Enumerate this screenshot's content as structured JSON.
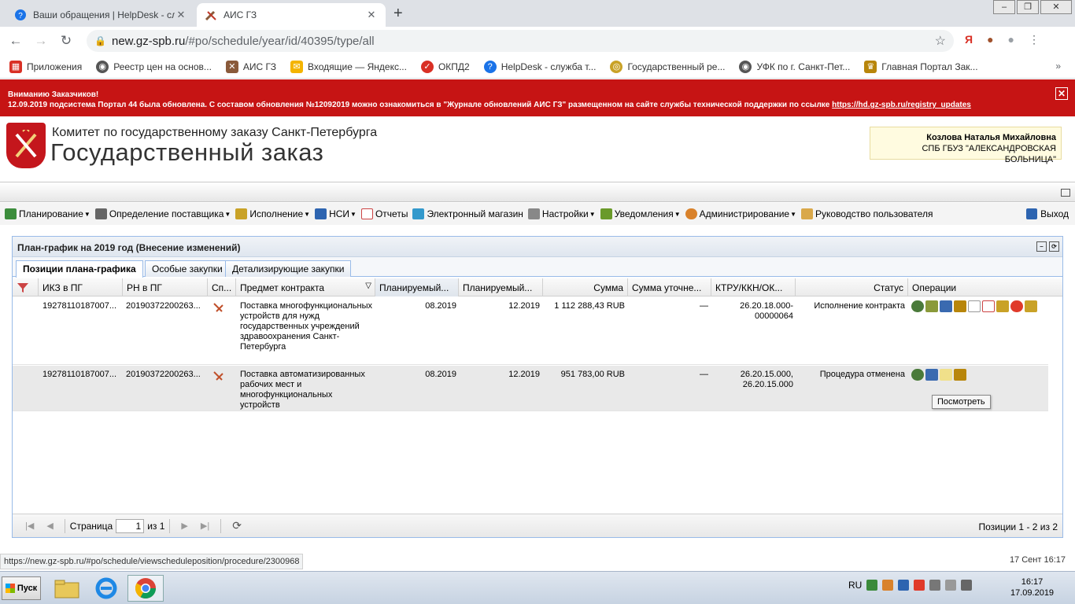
{
  "browser": {
    "tabs": [
      {
        "label": "Ваши обращения | HelpDesk - служ"
      },
      {
        "label": "АИС ГЗ"
      }
    ],
    "url_host": "new.gz-spb.ru",
    "url_path": "/#po/schedule/year/id/40395/type/all",
    "yandex": "Я",
    "bookmarks": [
      {
        "label": "Приложения",
        "color": "#d93025"
      },
      {
        "label": "Реестр цен на основ...",
        "color": "#555555"
      },
      {
        "label": "АИС ГЗ",
        "color": "#8a5a3a"
      },
      {
        "label": "Входящие — Яндекс...",
        "color": "#f4b400"
      },
      {
        "label": "ОКПД2",
        "color": "#d93025"
      },
      {
        "label": "HelpDesk - служба т...",
        "color": "#1a73e8"
      },
      {
        "label": "Государственный ре...",
        "color": "#c9a227"
      },
      {
        "label": "УФК по г. Санкт-Пет...",
        "color": "#555555"
      },
      {
        "label": "Главная Портал Зак...",
        "color": "#b8860b"
      }
    ],
    "bookmarks_more": "»"
  },
  "alert": {
    "line1": "Вниманию Заказчиков!",
    "line2": "12.09.2019 подсистема Портал 44 была обновлена. С составом обновления №12092019 можно ознакомиться в \"Журнале обновлений АИС ГЗ\" размещенном на сайте службы технической поддержки по ссылке",
    "link": "https://hd.gz-spb.ru/registry_updates"
  },
  "header": {
    "org_line1": "Комитет по государственному заказу Санкт-Петербурга",
    "org_line2": "Государственный заказ",
    "user_name": "Козлова Наталья Михайловна",
    "user_org": "СПБ ГБУЗ \"АЛЕКСАНДРОВСКАЯ БОЛЬНИЦА\""
  },
  "menu": {
    "items": [
      {
        "label": "Планирование",
        "dropdown": true,
        "color": "#3c8d3c"
      },
      {
        "label": "Определение поставщика",
        "dropdown": true,
        "color": "#666666"
      },
      {
        "label": "Исполнение",
        "dropdown": true,
        "color": "#c9a227"
      },
      {
        "label": "НСИ",
        "dropdown": true,
        "color": "#2d64b0"
      },
      {
        "label": "Отчеты",
        "dropdown": false,
        "color": "#cc4444"
      },
      {
        "label": "Электронный магазин",
        "dropdown": false,
        "color": "#3399cc"
      },
      {
        "label": "Настройки",
        "dropdown": true,
        "color": "#888888"
      },
      {
        "label": "Уведомления",
        "dropdown": true,
        "color": "#6a9a2a"
      },
      {
        "label": "Администрирование",
        "dropdown": true,
        "color": "#d9822b"
      },
      {
        "label": "Руководство пользователя",
        "dropdown": false,
        "color": "#d9a84a"
      }
    ],
    "exit": "Выход"
  },
  "panel": {
    "title": "План-график на 2019 год (Внесение изменений)",
    "tabs": [
      "Позиции плана-графика",
      "Особые закупки",
      "Детализирующие закупки"
    ],
    "columns": [
      "ИКЗ в ПГ",
      "РН в ПГ",
      "Сп...",
      "Предмет контракта",
      "Планируемый...",
      "Планируемый...",
      "Сумма",
      "Сумма уточне...",
      "КТРУ/ККН/ОК...",
      "Статус",
      "Операции"
    ],
    "rows": [
      {
        "ikz": "19278110187007...",
        "rn": "20190372200263...",
        "subject": "Поставка многофункциональных устройств для нужд государственных учреждений здравоохранения Санкт-Петербурга",
        "plan_start": "08.2019",
        "plan_end": "12.2019",
        "sum": "1 112 288,43 RUB",
        "sum_spec": "—",
        "ktru": "26.20.18.000-00000064",
        "status": "Исполнение контракта"
      },
      {
        "ikz": "19278110187007...",
        "rn": "20190372200263...",
        "subject": "Поставка автоматизированных рабочих мест и многофункциональных устройств",
        "plan_start": "08.2019",
        "plan_end": "12.2019",
        "sum": "951 783,00 RUB",
        "sum_spec": "—",
        "ktru": "26.20.15.000, 26.20.15.000",
        "status": "Процедура отменена"
      }
    ],
    "tooltip": "Посмотреть",
    "pager": {
      "page_label": "Страница",
      "page_value": "1",
      "of_label": "из 1",
      "info": "Позиции 1 - 2 из 2"
    }
  },
  "status": {
    "url": "https://new.gz-spb.ru/#po/schedule/viewscheduleposition/procedure/2300968",
    "date": "17 Сент 16:17"
  },
  "taskbar": {
    "start": "Пуск",
    "lang": "RU",
    "time": "16:17",
    "date": "17.09.2019"
  }
}
